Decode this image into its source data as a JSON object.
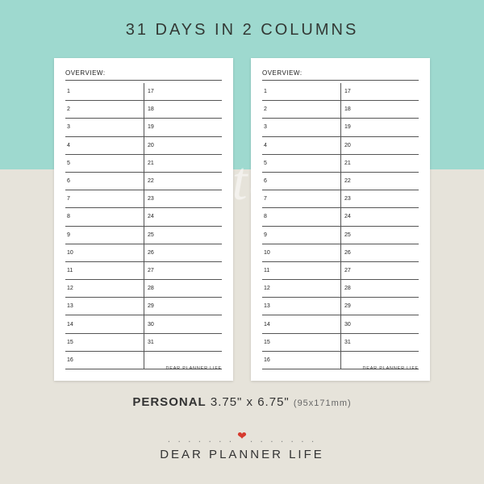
{
  "title": "31 DAYS IN 2 COLUMNS",
  "watermark": "printable",
  "page": {
    "overview_label": "OVERVIEW:",
    "col1": [
      "1",
      "2",
      "3",
      "4",
      "5",
      "6",
      "7",
      "8",
      "9",
      "10",
      "11",
      "12",
      "13",
      "14",
      "15",
      "16"
    ],
    "col2": [
      "17",
      "18",
      "19",
      "20",
      "21",
      "22",
      "23",
      "24",
      "25",
      "26",
      "27",
      "28",
      "29",
      "30",
      "31",
      ""
    ],
    "footer": "DEAR PLANNER LIFE"
  },
  "size": {
    "label": "PERSONAL",
    "dims": "3.75\" x 6.75\"",
    "mm": "(95x171mm)"
  },
  "divider": {
    "dots_left": ". . . . . . .",
    "heart": "❤",
    "dots_right": ". . . . . . ."
  },
  "brand": "DEAR PLANNER LIFE"
}
